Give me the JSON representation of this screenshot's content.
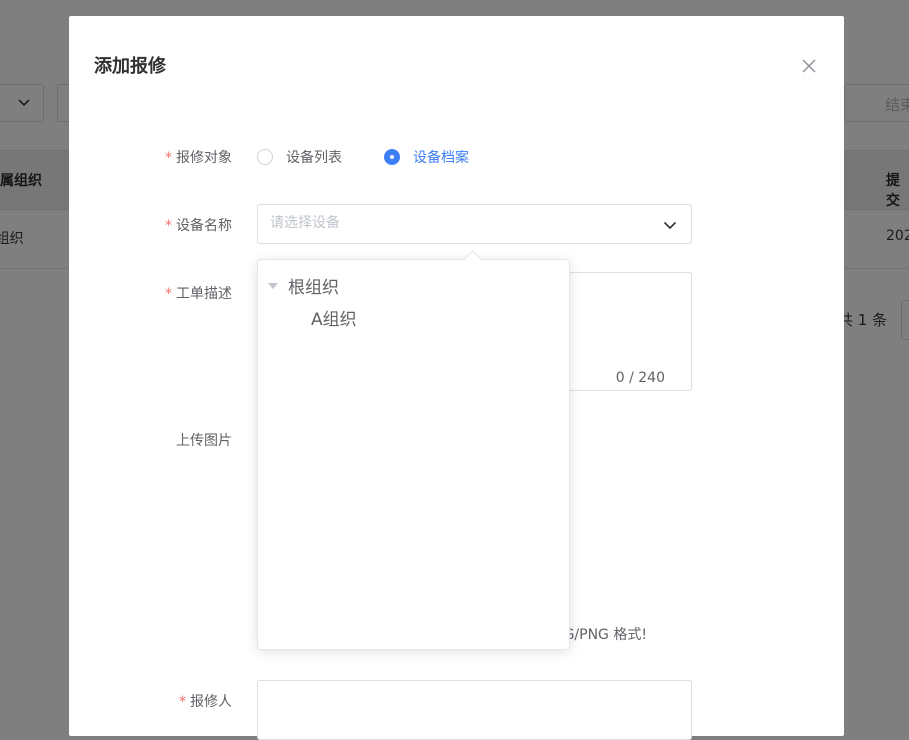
{
  "background": {
    "search_placeholder_tail": "结束",
    "table_headers": {
      "org": "所属组织",
      "submitted": "提交"
    },
    "table_row": {
      "org": "A组织",
      "submitted": "202"
    },
    "pagination_total": "共 1 条"
  },
  "dialog": {
    "title": "添加报修",
    "fields": {
      "target": {
        "label": "报修对象",
        "options": [
          {
            "label": "设备列表",
            "checked": false
          },
          {
            "label": "设备档案",
            "checked": true
          }
        ]
      },
      "device": {
        "label": "设备名称",
        "placeholder": "请选择设备",
        "value": ""
      },
      "description": {
        "label": "工单描述",
        "counter": "0 / 240"
      },
      "upload": {
        "label": "上传图片",
        "hint": "JPG/PNG 格式!"
      },
      "reporter": {
        "label": "报修人"
      }
    },
    "dropdown_tree": [
      {
        "label": "根组织",
        "expanded": true,
        "children": [
          {
            "label": "A组织"
          }
        ]
      }
    ]
  },
  "colors": {
    "primary": "#3d7ff5",
    "required": "#f56c6c",
    "overlay": "#7f7f7f"
  }
}
